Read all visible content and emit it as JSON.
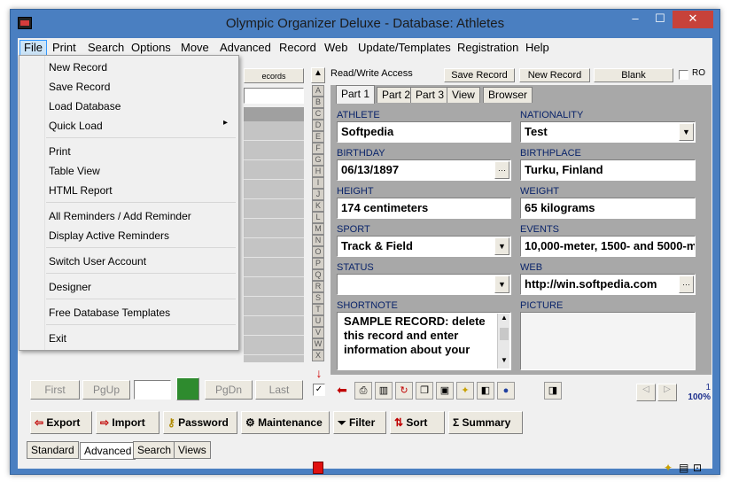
{
  "window": {
    "title": "Olympic Organizer Deluxe - Database: Athletes",
    "minimize": "–",
    "maximize": "☐",
    "close": "✕"
  },
  "menubar": [
    "File",
    "Print",
    "Search",
    "Options",
    "Move",
    "Advanced",
    "Record",
    "Web",
    "Update/Templates",
    "Registration",
    "Help"
  ],
  "file_menu": {
    "items": [
      "New Record",
      "Save Record",
      "Load Database",
      "Quick Load",
      "Print",
      "Table View",
      "HTML Report",
      "All Reminders / Add Reminder",
      "Display Active Reminders",
      "Switch User Account",
      "Designer",
      "Free Database Templates",
      "Exit"
    ],
    "submenu_arrow": "▸"
  },
  "list_header": {
    "records_fragment": "ecords"
  },
  "letters": [
    "A",
    "B",
    "C",
    "D",
    "E",
    "F",
    "G",
    "H",
    "I",
    "J",
    "K",
    "L",
    "M",
    "N",
    "O",
    "P",
    "Q",
    "R",
    "S",
    "T",
    "U",
    "V",
    "W",
    "X"
  ],
  "nav": {
    "first": "First",
    "pgup": "PgUp",
    "pgdn": "PgDn",
    "last": "Last"
  },
  "topbar": {
    "access": "Read/Write Access",
    "save": "Save Record",
    "new": "New Record",
    "blank": "Blank",
    "ro": "RO"
  },
  "tabs": [
    "Part 1",
    "Part 2",
    "Part 3",
    "View",
    "Browser"
  ],
  "fields": {
    "athlete_label": "ATHLETE",
    "athlete": "Softpedia",
    "nationality_label": "NATIONALITY",
    "nationality": "Test",
    "birthday_label": "BIRTHDAY",
    "birthday": "06/13/1897",
    "birthplace_label": "BIRTHPLACE",
    "birthplace": "Turku, Finland",
    "height_label": "HEIGHT",
    "height": "174 centimeters",
    "weight_label": "WEIGHT",
    "weight": "65 kilograms",
    "sport_label": "SPORT",
    "sport": "Track & Field",
    "events_label": "EVENTS",
    "events": "10,000-meter, 1500- and 5000-m",
    "status_label": "STATUS",
    "status": "",
    "web_label": "WEB",
    "web": "http://win.softpedia.com",
    "shortnote_label": "SHORTNOTE",
    "shortnote": "SAMPLE RECORD: delete this record and enter information about your",
    "picture_label": "PICTURE",
    "ellipsis": "···"
  },
  "status": {
    "page": "1",
    "zoom": "100%"
  },
  "bottom_buttons": [
    "Export",
    "Import",
    "Password",
    "Maintenance",
    "Filter",
    "Sort",
    "Summary"
  ],
  "bottom_tabs": [
    "Standard",
    "Advanced",
    "Search",
    "Views"
  ]
}
